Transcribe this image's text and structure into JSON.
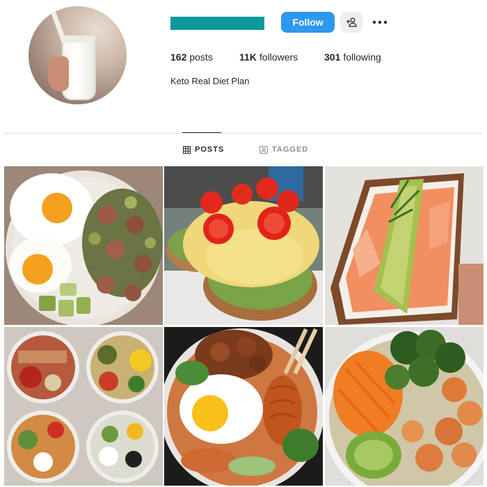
{
  "profile": {
    "username_redacted_color": "#0b9a9a",
    "avatar_icon": "profile-avatar",
    "bio": "Keto Real Diet Plan"
  },
  "actions": {
    "follow_label": "Follow",
    "follow_color": "#2c98f0",
    "suggest_icon": "person-add-icon",
    "more_icon": "more-horizontal-icon"
  },
  "stats": {
    "posts_count": "162",
    "posts_label": "posts",
    "followers_count": "11K",
    "followers_label": "followers",
    "following_count": "301",
    "following_label": "following"
  },
  "tabs": [
    {
      "label": "POSTS",
      "icon": "grid-icon",
      "active": true
    },
    {
      "label": "TAGGED",
      "icon": "tagged-icon",
      "active": false
    }
  ],
  "posts": [
    {
      "icon": "post-eggs-sausage-bowl"
    },
    {
      "icon": "post-egg-avocado-toast"
    },
    {
      "icon": "post-salmon-avocado-toast"
    },
    {
      "icon": "post-meal-prep-bowls"
    },
    {
      "icon": "post-egg-noodle-bowl"
    },
    {
      "icon": "post-shrimp-broccoli-bowl"
    }
  ]
}
